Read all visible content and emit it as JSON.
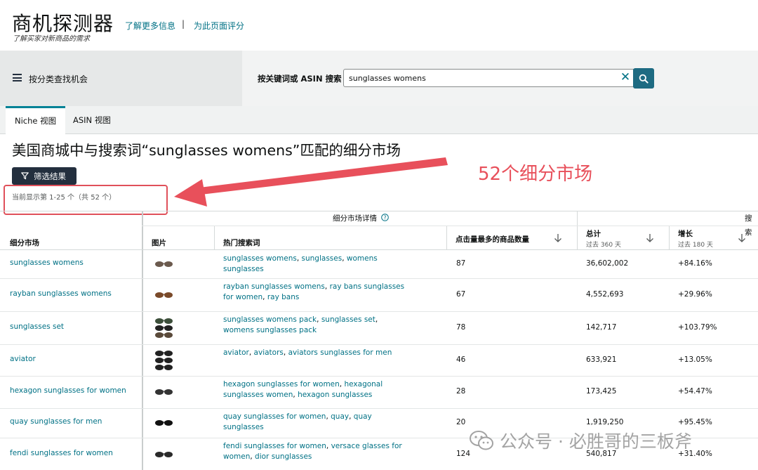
{
  "header": {
    "app_title": "商机探测器",
    "subtitle": "了解买家对新商品的需求",
    "learn_more": "了解更多信息",
    "separator": "|",
    "rate_page": "为此页面评分"
  },
  "search_band": {
    "browse_label": "按分类查找机会",
    "search_label": "按关键词或 ASIN 搜索",
    "search_value": "sunglasses womens",
    "clear_symbol": "✕"
  },
  "tabs": [
    {
      "label": "Niche 视图",
      "active": true
    },
    {
      "label": "ASIN 视图",
      "active": false
    }
  ],
  "page": {
    "title": "美国商城中与搜索词“sunglasses womens”匹配的细分市场",
    "filter_button": "筛选结果",
    "range_text": "当前显示第 1-25 个（共 52 个）",
    "annotation": "52个细分市场"
  },
  "table": {
    "group_detail": "细分市场详情",
    "group_search": "搜索",
    "headers": {
      "niche": "细分市场",
      "image": "图片",
      "top_terms": "热门搜索词",
      "clicked_products": "点击量最多的商品数量",
      "total": "总计",
      "total_sub": "过去 360 天",
      "growth": "增长",
      "growth_sub": "过去 180 天"
    },
    "rows": [
      {
        "niche": "sunglasses womens",
        "terms": [
          "sunglasses womens",
          "sunglasses",
          "womens sunglasses"
        ],
        "clicked": "87",
        "total": "36,602,002",
        "growth": "+84.16%"
      },
      {
        "niche": "rayban sunglasses womens",
        "terms": [
          "rayban sunglasses womens",
          "ray bans sunglasses for women",
          "ray bans"
        ],
        "clicked": "67",
        "total": "4,552,693",
        "growth": "+29.96%"
      },
      {
        "niche": "sunglasses set",
        "terms": [
          "sunglasses womens pack",
          "sunglasses set",
          "womens sunglasses pack"
        ],
        "clicked": "78",
        "total": "142,717",
        "growth": "+103.79%"
      },
      {
        "niche": "aviator",
        "terms": [
          "aviator",
          "aviators",
          "aviators sunglasses for men"
        ],
        "clicked": "46",
        "total": "633,921",
        "growth": "+13.05%"
      },
      {
        "niche": "hexagon sunglasses for women",
        "terms": [
          "hexagon sunglasses for women",
          "hexagonal sunglasses women",
          "hexagon sunglasses"
        ],
        "clicked": "28",
        "total": "173,425",
        "growth": "+54.47%"
      },
      {
        "niche": "quay sunglasses for men",
        "terms": [
          "quay sunglasses for women",
          "quay",
          "quay sunglasses"
        ],
        "clicked": "20",
        "total": "1,919,250",
        "growth": "+95.45%"
      },
      {
        "niche": "fendi sunglasses for women",
        "terms": [
          "fendi sunglasses for women",
          "versace glasses for women",
          "dior sunglasses"
        ],
        "clicked": "124",
        "total": "540,817",
        "growth": "+31.40%"
      }
    ]
  },
  "watermark": "公众号 · 必胜哥的三板斧",
  "colors": {
    "link": "#007185",
    "dark_button": "#232f3e",
    "search_button": "#1e6b82",
    "annotation_red": "#e8505b",
    "tab_accent": "#008296"
  }
}
